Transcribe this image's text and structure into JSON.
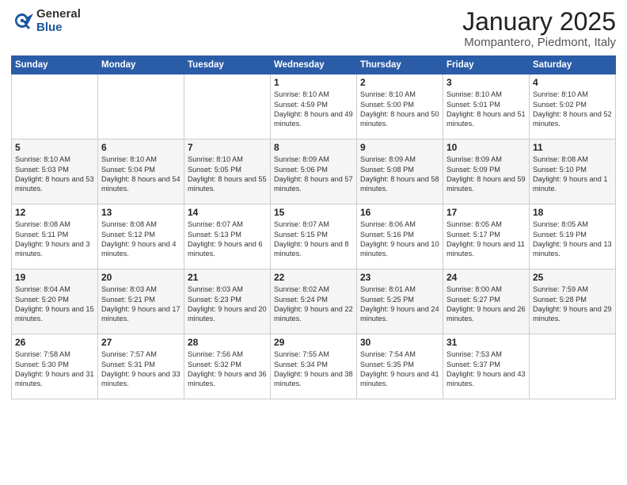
{
  "header": {
    "logo_general": "General",
    "logo_blue": "Blue",
    "title": "January 2025",
    "location": "Mompantero, Piedmont, Italy"
  },
  "days_of_week": [
    "Sunday",
    "Monday",
    "Tuesday",
    "Wednesday",
    "Thursday",
    "Friday",
    "Saturday"
  ],
  "weeks": [
    [
      {
        "day": "",
        "content": ""
      },
      {
        "day": "",
        "content": ""
      },
      {
        "day": "",
        "content": ""
      },
      {
        "day": "1",
        "content": "Sunrise: 8:10 AM\nSunset: 4:59 PM\nDaylight: 8 hours\nand 49 minutes."
      },
      {
        "day": "2",
        "content": "Sunrise: 8:10 AM\nSunset: 5:00 PM\nDaylight: 8 hours\nand 50 minutes."
      },
      {
        "day": "3",
        "content": "Sunrise: 8:10 AM\nSunset: 5:01 PM\nDaylight: 8 hours\nand 51 minutes."
      },
      {
        "day": "4",
        "content": "Sunrise: 8:10 AM\nSunset: 5:02 PM\nDaylight: 8 hours\nand 52 minutes."
      }
    ],
    [
      {
        "day": "5",
        "content": "Sunrise: 8:10 AM\nSunset: 5:03 PM\nDaylight: 8 hours\nand 53 minutes."
      },
      {
        "day": "6",
        "content": "Sunrise: 8:10 AM\nSunset: 5:04 PM\nDaylight: 8 hours\nand 54 minutes."
      },
      {
        "day": "7",
        "content": "Sunrise: 8:10 AM\nSunset: 5:05 PM\nDaylight: 8 hours\nand 55 minutes."
      },
      {
        "day": "8",
        "content": "Sunrise: 8:09 AM\nSunset: 5:06 PM\nDaylight: 8 hours\nand 57 minutes."
      },
      {
        "day": "9",
        "content": "Sunrise: 8:09 AM\nSunset: 5:08 PM\nDaylight: 8 hours\nand 58 minutes."
      },
      {
        "day": "10",
        "content": "Sunrise: 8:09 AM\nSunset: 5:09 PM\nDaylight: 8 hours\nand 59 minutes."
      },
      {
        "day": "11",
        "content": "Sunrise: 8:08 AM\nSunset: 5:10 PM\nDaylight: 9 hours\nand 1 minute."
      }
    ],
    [
      {
        "day": "12",
        "content": "Sunrise: 8:08 AM\nSunset: 5:11 PM\nDaylight: 9 hours\nand 3 minutes."
      },
      {
        "day": "13",
        "content": "Sunrise: 8:08 AM\nSunset: 5:12 PM\nDaylight: 9 hours\nand 4 minutes."
      },
      {
        "day": "14",
        "content": "Sunrise: 8:07 AM\nSunset: 5:13 PM\nDaylight: 9 hours\nand 6 minutes."
      },
      {
        "day": "15",
        "content": "Sunrise: 8:07 AM\nSunset: 5:15 PM\nDaylight: 9 hours\nand 8 minutes."
      },
      {
        "day": "16",
        "content": "Sunrise: 8:06 AM\nSunset: 5:16 PM\nDaylight: 9 hours\nand 10 minutes."
      },
      {
        "day": "17",
        "content": "Sunrise: 8:05 AM\nSunset: 5:17 PM\nDaylight: 9 hours\nand 11 minutes."
      },
      {
        "day": "18",
        "content": "Sunrise: 8:05 AM\nSunset: 5:19 PM\nDaylight: 9 hours\nand 13 minutes."
      }
    ],
    [
      {
        "day": "19",
        "content": "Sunrise: 8:04 AM\nSunset: 5:20 PM\nDaylight: 9 hours\nand 15 minutes."
      },
      {
        "day": "20",
        "content": "Sunrise: 8:03 AM\nSunset: 5:21 PM\nDaylight: 9 hours\nand 17 minutes."
      },
      {
        "day": "21",
        "content": "Sunrise: 8:03 AM\nSunset: 5:23 PM\nDaylight: 9 hours\nand 20 minutes."
      },
      {
        "day": "22",
        "content": "Sunrise: 8:02 AM\nSunset: 5:24 PM\nDaylight: 9 hours\nand 22 minutes."
      },
      {
        "day": "23",
        "content": "Sunrise: 8:01 AM\nSunset: 5:25 PM\nDaylight: 9 hours\nand 24 minutes."
      },
      {
        "day": "24",
        "content": "Sunrise: 8:00 AM\nSunset: 5:27 PM\nDaylight: 9 hours\nand 26 minutes."
      },
      {
        "day": "25",
        "content": "Sunrise: 7:59 AM\nSunset: 5:28 PM\nDaylight: 9 hours\nand 29 minutes."
      }
    ],
    [
      {
        "day": "26",
        "content": "Sunrise: 7:58 AM\nSunset: 5:30 PM\nDaylight: 9 hours\nand 31 minutes."
      },
      {
        "day": "27",
        "content": "Sunrise: 7:57 AM\nSunset: 5:31 PM\nDaylight: 9 hours\nand 33 minutes."
      },
      {
        "day": "28",
        "content": "Sunrise: 7:56 AM\nSunset: 5:32 PM\nDaylight: 9 hours\nand 36 minutes."
      },
      {
        "day": "29",
        "content": "Sunrise: 7:55 AM\nSunset: 5:34 PM\nDaylight: 9 hours\nand 38 minutes."
      },
      {
        "day": "30",
        "content": "Sunrise: 7:54 AM\nSunset: 5:35 PM\nDaylight: 9 hours\nand 41 minutes."
      },
      {
        "day": "31",
        "content": "Sunrise: 7:53 AM\nSunset: 5:37 PM\nDaylight: 9 hours\nand 43 minutes."
      },
      {
        "day": "",
        "content": ""
      }
    ]
  ]
}
